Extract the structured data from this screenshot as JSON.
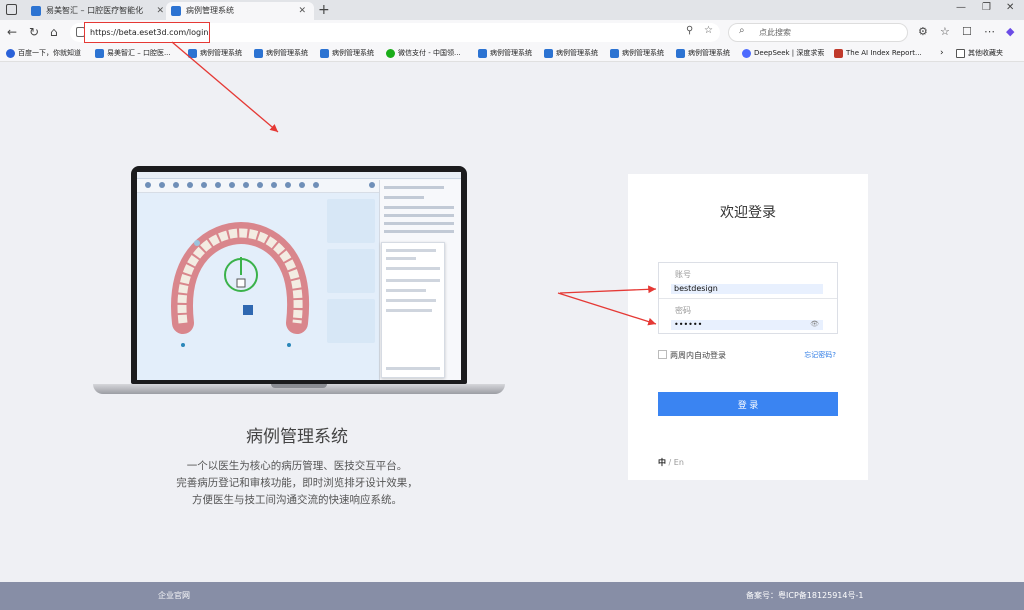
{
  "browser": {
    "tabs": [
      {
        "title": "易美智汇 – 口腔医疗智能化",
        "active": false
      },
      {
        "title": "病例管理系统",
        "active": true
      }
    ],
    "url": "https://beta.eset3d.com/login",
    "search_placeholder": "点此搜索",
    "bookmarks": [
      {
        "label": "百度一下，你就知道",
        "icon": "paw-icon"
      },
      {
        "label": "易美智汇 – 口腔医...",
        "icon": "eset-icon"
      },
      {
        "label": "病例管理系统",
        "icon": "eset-icon"
      },
      {
        "label": "病例管理系统",
        "icon": "eset-icon"
      },
      {
        "label": "病例管理系统",
        "icon": "eset-icon"
      },
      {
        "label": "微信支付 - 中国领...",
        "icon": "wechat-pay-icon"
      },
      {
        "label": "病例管理系统",
        "icon": "eset-icon"
      },
      {
        "label": "病例管理系统",
        "icon": "eset-icon"
      },
      {
        "label": "病例管理系统",
        "icon": "eset-icon"
      },
      {
        "label": "病例管理系统",
        "icon": "eset-icon"
      },
      {
        "label": "DeepSeek | 深度求索",
        "icon": "deepseek-icon"
      },
      {
        "label": "The AI Index Report...",
        "icon": "stanford-icon"
      }
    ],
    "other_bookmarks": "其他收藏夹"
  },
  "hero": {
    "title": "病例管理系统",
    "description_lines": [
      "一个以医生为核心的病历管理、医技交互平台。",
      "完善病历登记和审核功能，即时浏览排牙设计效果，",
      "方便医生与技工间沟通交流的快速响应系统。"
    ]
  },
  "login": {
    "title": "欢迎登录",
    "account_label": "账号",
    "account_value": "bestdesign",
    "password_label": "密码",
    "password_value": "••••••",
    "remember_label": "两周内自动登录",
    "forgot_label": "忘记密码?",
    "submit_label": "登 录",
    "lang_zh": "中",
    "lang_sep": "/",
    "lang_en": "En"
  },
  "footer": {
    "left": "企业官网",
    "right": "备案号：粤ICP备18125914号-1"
  },
  "colors": {
    "primary": "#3a84f2",
    "annotation": "#e53935",
    "footer": "#878ea6"
  }
}
